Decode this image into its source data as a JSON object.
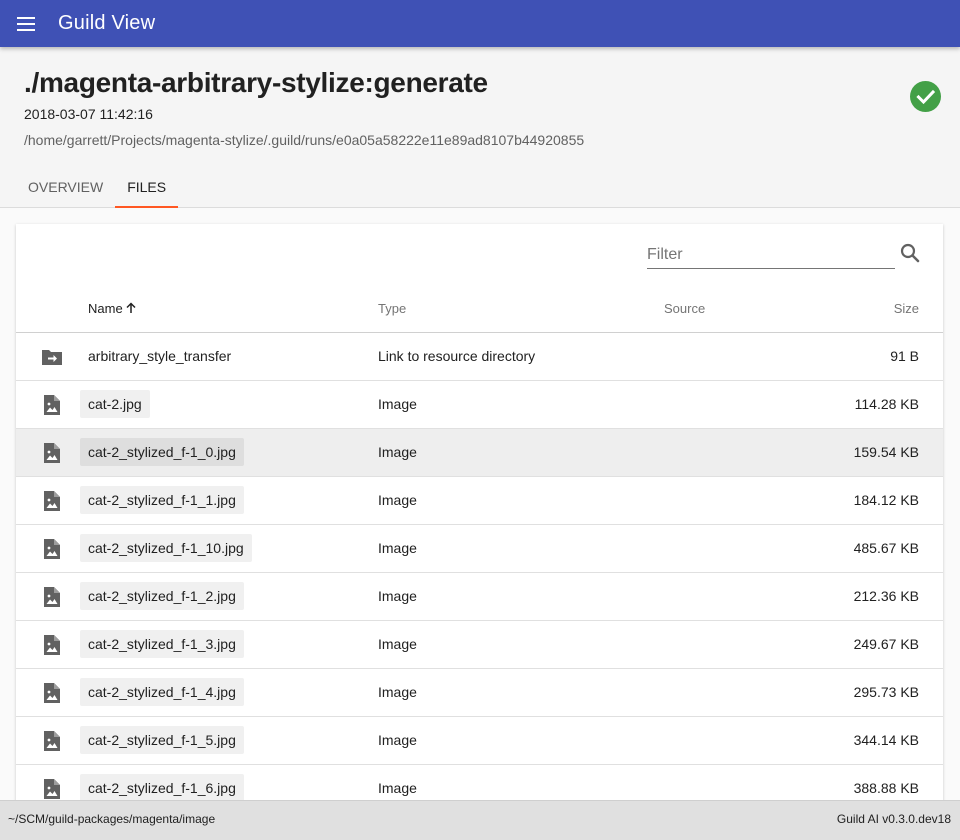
{
  "appbar": {
    "title": "Guild View",
    "menu_icon": "menu-icon"
  },
  "run": {
    "title": "./magenta-arbitrary-stylize:generate",
    "started": "2018-03-07 11:42:16",
    "path": "/home/garrett/Projects/magenta-stylize/.guild/runs/e0a05a58222e11e89ad8107b44920855",
    "status_icon": "check-circle-icon",
    "status_color": "#43a047"
  },
  "tabs": [
    {
      "label": "OVERVIEW",
      "active": false
    },
    {
      "label": "FILES",
      "active": true
    }
  ],
  "accent_color": "#ff5722",
  "brand_color": "#3f51b5",
  "files": {
    "filter": {
      "placeholder": "Filter",
      "value": ""
    },
    "columns": {
      "name": "Name",
      "type": "Type",
      "source": "Source",
      "size": "Size"
    },
    "sort": {
      "column": "name",
      "direction": "ascending"
    },
    "rows": [
      {
        "icon": "folder-link-icon",
        "name": "arbitrary_style_transfer",
        "type": "Link to resource directory",
        "source": "",
        "size": "91 B"
      },
      {
        "icon": "image-file-icon",
        "name": "cat-2.jpg",
        "type": "Image",
        "source": "",
        "size": "114.28 KB"
      },
      {
        "icon": "image-file-icon",
        "name": "cat-2_stylized_f-1_0.jpg",
        "type": "Image",
        "source": "",
        "size": "159.54 KB"
      },
      {
        "icon": "image-file-icon",
        "name": "cat-2_stylized_f-1_1.jpg",
        "type": "Image",
        "source": "",
        "size": "184.12 KB"
      },
      {
        "icon": "image-file-icon",
        "name": "cat-2_stylized_f-1_10.jpg",
        "type": "Image",
        "source": "",
        "size": "485.67 KB"
      },
      {
        "icon": "image-file-icon",
        "name": "cat-2_stylized_f-1_2.jpg",
        "type": "Image",
        "source": "",
        "size": "212.36 KB"
      },
      {
        "icon": "image-file-icon",
        "name": "cat-2_stylized_f-1_3.jpg",
        "type": "Image",
        "source": "",
        "size": "249.67 KB"
      },
      {
        "icon": "image-file-icon",
        "name": "cat-2_stylized_f-1_4.jpg",
        "type": "Image",
        "source": "",
        "size": "295.73 KB"
      },
      {
        "icon": "image-file-icon",
        "name": "cat-2_stylized_f-1_5.jpg",
        "type": "Image",
        "source": "",
        "size": "344.14 KB"
      },
      {
        "icon": "image-file-icon",
        "name": "cat-2_stylized_f-1_6.jpg",
        "type": "Image",
        "source": "",
        "size": "388.88 KB"
      }
    ]
  },
  "footer": {
    "cwd": "~/SCM/guild-packages/magenta/image",
    "version": "Guild AI v0.3.0.dev18"
  }
}
